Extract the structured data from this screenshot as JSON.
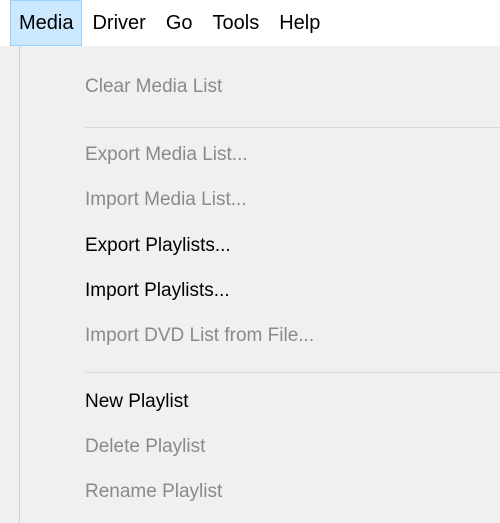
{
  "menubar": {
    "items": [
      {
        "label": "Media",
        "active": true
      },
      {
        "label": "Driver",
        "active": false
      },
      {
        "label": "Go",
        "active": false
      },
      {
        "label": "Tools",
        "active": false
      },
      {
        "label": "Help",
        "active": false
      }
    ]
  },
  "media_menu": {
    "items": [
      {
        "label": "Clear Media List",
        "enabled": false
      },
      {
        "label": "Export Media List...",
        "enabled": false
      },
      {
        "label": "Import Media List...",
        "enabled": false
      },
      {
        "label": "Export Playlists...",
        "enabled": true
      },
      {
        "label": "Import Playlists...",
        "enabled": true
      },
      {
        "label": "Import DVD List from File...",
        "enabled": false
      },
      {
        "label": "New Playlist",
        "enabled": true
      },
      {
        "label": "Delete Playlist",
        "enabled": false
      },
      {
        "label": "Rename Playlist",
        "enabled": false
      }
    ]
  }
}
